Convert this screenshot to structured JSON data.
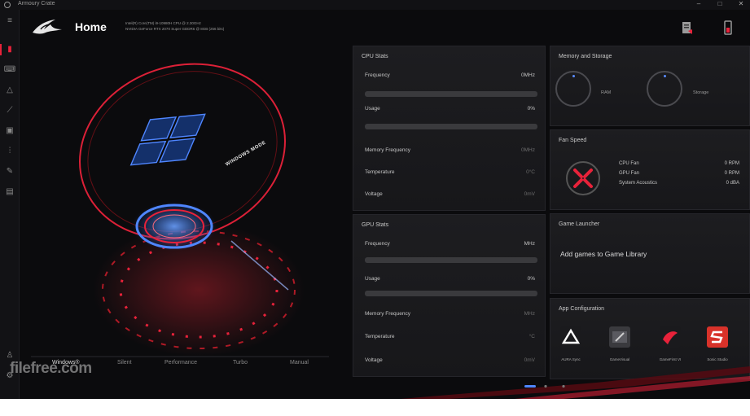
{
  "window": {
    "app_title": "Armoury Crate",
    "minimize": "–",
    "maximize": "□",
    "close": "✕"
  },
  "header": {
    "title": "Home",
    "specs": [
      "Intel(R) Core(TM) i9-10980H CPU @ 2.30GHz",
      "NVIDIA GeForce RTX 2070 Super GDDR6 @ 8GB (256 bits)"
    ]
  },
  "hero": {
    "mode_badge": "WINDOWS MODE",
    "mode_tabs": [
      "Windows®",
      "Silent",
      "Performance",
      "Turbo",
      "Manual"
    ],
    "active_mode": "Windows®",
    "watermark": "filefree.com"
  },
  "cpu_stats": {
    "title": "CPU Stats",
    "frequency_label": "Frequency",
    "frequency_value": "0MHz",
    "usage_label": "Usage",
    "usage_value": "0%",
    "usage_fraction": 0,
    "mem_freq_label": "Memory Frequency",
    "mem_freq_value": "0MHz",
    "temp_label": "Temperature",
    "temp_value": "0°C",
    "voltage_label": "Voltage",
    "voltage_value": "0mV"
  },
  "gpu_stats": {
    "title": "GPU Stats",
    "frequency_label": "Frequency",
    "frequency_value": "MHz",
    "usage_label": "Usage",
    "usage_value": "0%",
    "usage_fraction": 0,
    "mem_freq_label": "Memory Frequency",
    "mem_freq_value": "MHz",
    "temp_label": "Temperature",
    "temp_value": "°C",
    "voltage_label": "Voltage",
    "voltage_value": "0mV"
  },
  "memory_storage": {
    "title": "Memory and Storage",
    "ram_label": "RAM",
    "storage_label": "Storage"
  },
  "fan_speed": {
    "title": "Fan Speed",
    "fans": [
      {
        "name": "CPU Fan",
        "value": "0 RPM"
      },
      {
        "name": "GPU Fan",
        "value": "0 RPM"
      },
      {
        "name": "System Acoustics",
        "value": "0 dBA"
      }
    ]
  },
  "game_launcher": {
    "title": "Game Launcher",
    "cta": "Add games to Game Library"
  },
  "app_config": {
    "title": "App Configuration",
    "apps": [
      {
        "label": "AURA Sync",
        "icon": "aura-sync-icon",
        "color": "#222226"
      },
      {
        "label": "GameVisual",
        "icon": "gamevisual-icon",
        "color": "#3a3a3e"
      },
      {
        "label": "GameFirst VI",
        "icon": "gamefirst-icon",
        "color": "#2a1a1c"
      },
      {
        "label": "Sonic Studio",
        "icon": "sonic-studio-icon",
        "color": "#d8322a"
      }
    ]
  },
  "colors": {
    "accent": "#e8223a",
    "panel": "#1b1b1e",
    "background": "#0b0b0d"
  },
  "sidebar": {
    "icons": [
      "menu-icon",
      "home-icon",
      "device-icon",
      "aura-icon",
      "armoury-icon",
      "gamevisual-icon",
      "settings-icon",
      "scenario-icon",
      "tag-icon",
      "display-icon",
      "user-icon",
      "gear-icon"
    ]
  }
}
